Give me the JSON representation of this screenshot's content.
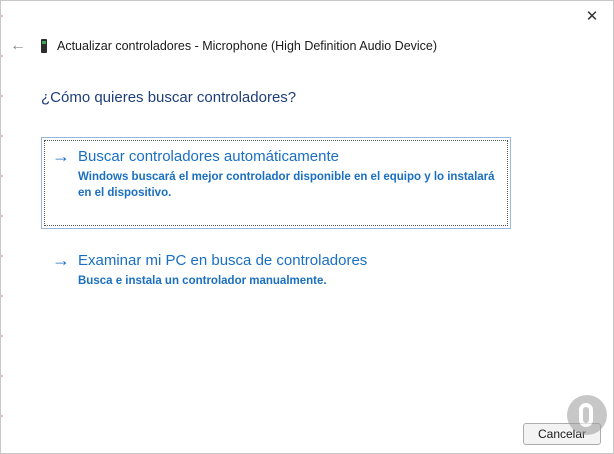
{
  "window": {
    "close_glyph": "✕",
    "back_glyph": "←",
    "title": "Actualizar controladores - Microphone (High Definition Audio Device)"
  },
  "main": {
    "question": "¿Cómo quieres buscar controladores?",
    "options": [
      {
        "title": "Buscar controladores automáticamente",
        "description": "Windows buscará el mejor controlador disponible en el equipo y lo instalará en el dispositivo.",
        "icon": "arrow-right-icon"
      },
      {
        "title": "Examinar mi PC en busca de controladores",
        "description": "Busca e instala un controlador manualmente.",
        "icon": "arrow-right-icon"
      }
    ]
  },
  "footer": {
    "cancel_label": "Cancelar"
  },
  "colors": {
    "link": "#1a6fc2",
    "heading": "#1e3e7a"
  }
}
